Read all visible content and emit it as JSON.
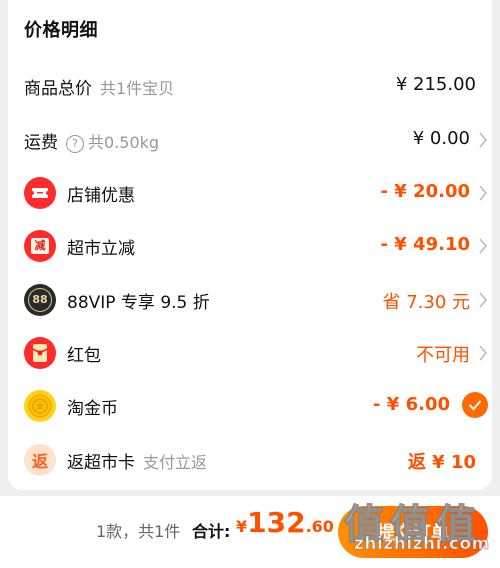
{
  "header": {
    "title": "价格明细"
  },
  "rows": [
    {
      "label": "商品总价",
      "sub": "共1件宝贝",
      "value": "¥ 215.00"
    },
    {
      "label": "运费",
      "sub": "共0.50kg",
      "value": "¥ 0.00"
    },
    {
      "label": "店铺优惠",
      "value": "- ¥ 20.00",
      "icon": "shop-coupon-icon"
    },
    {
      "label": "超市立减",
      "value": "- ¥ 49.10",
      "icon": "supermarket-discount-icon",
      "icon_text": "减"
    },
    {
      "label": "88VIP 专享 9.5 折",
      "value": "省 7.30 元",
      "icon": "88vip-icon",
      "icon_text": "88"
    },
    {
      "label": "红包",
      "value": "不可用",
      "icon": "red-packet-icon"
    },
    {
      "label": "淘金币",
      "value": "- ¥ 6.00",
      "icon": "taojinbi-coin-icon",
      "checked": true
    },
    {
      "label": "返超市卡",
      "sub": "支付立返",
      "value": "返 ¥ 10",
      "icon": "cashback-card-icon",
      "icon_text": "返"
    }
  ],
  "footer": {
    "summary": "1款，共1件",
    "total_label": "合计:",
    "total_currency": "¥",
    "total_int": "132",
    "total_dec": ".60",
    "submit_label": "提交订单"
  },
  "watermark": {
    "glyphs": "值值值",
    "url": "zhizhizhi.com"
  },
  "colors": {
    "accent": "#ff5000",
    "accent_light": "#ff9000",
    "muted": "#999999"
  }
}
